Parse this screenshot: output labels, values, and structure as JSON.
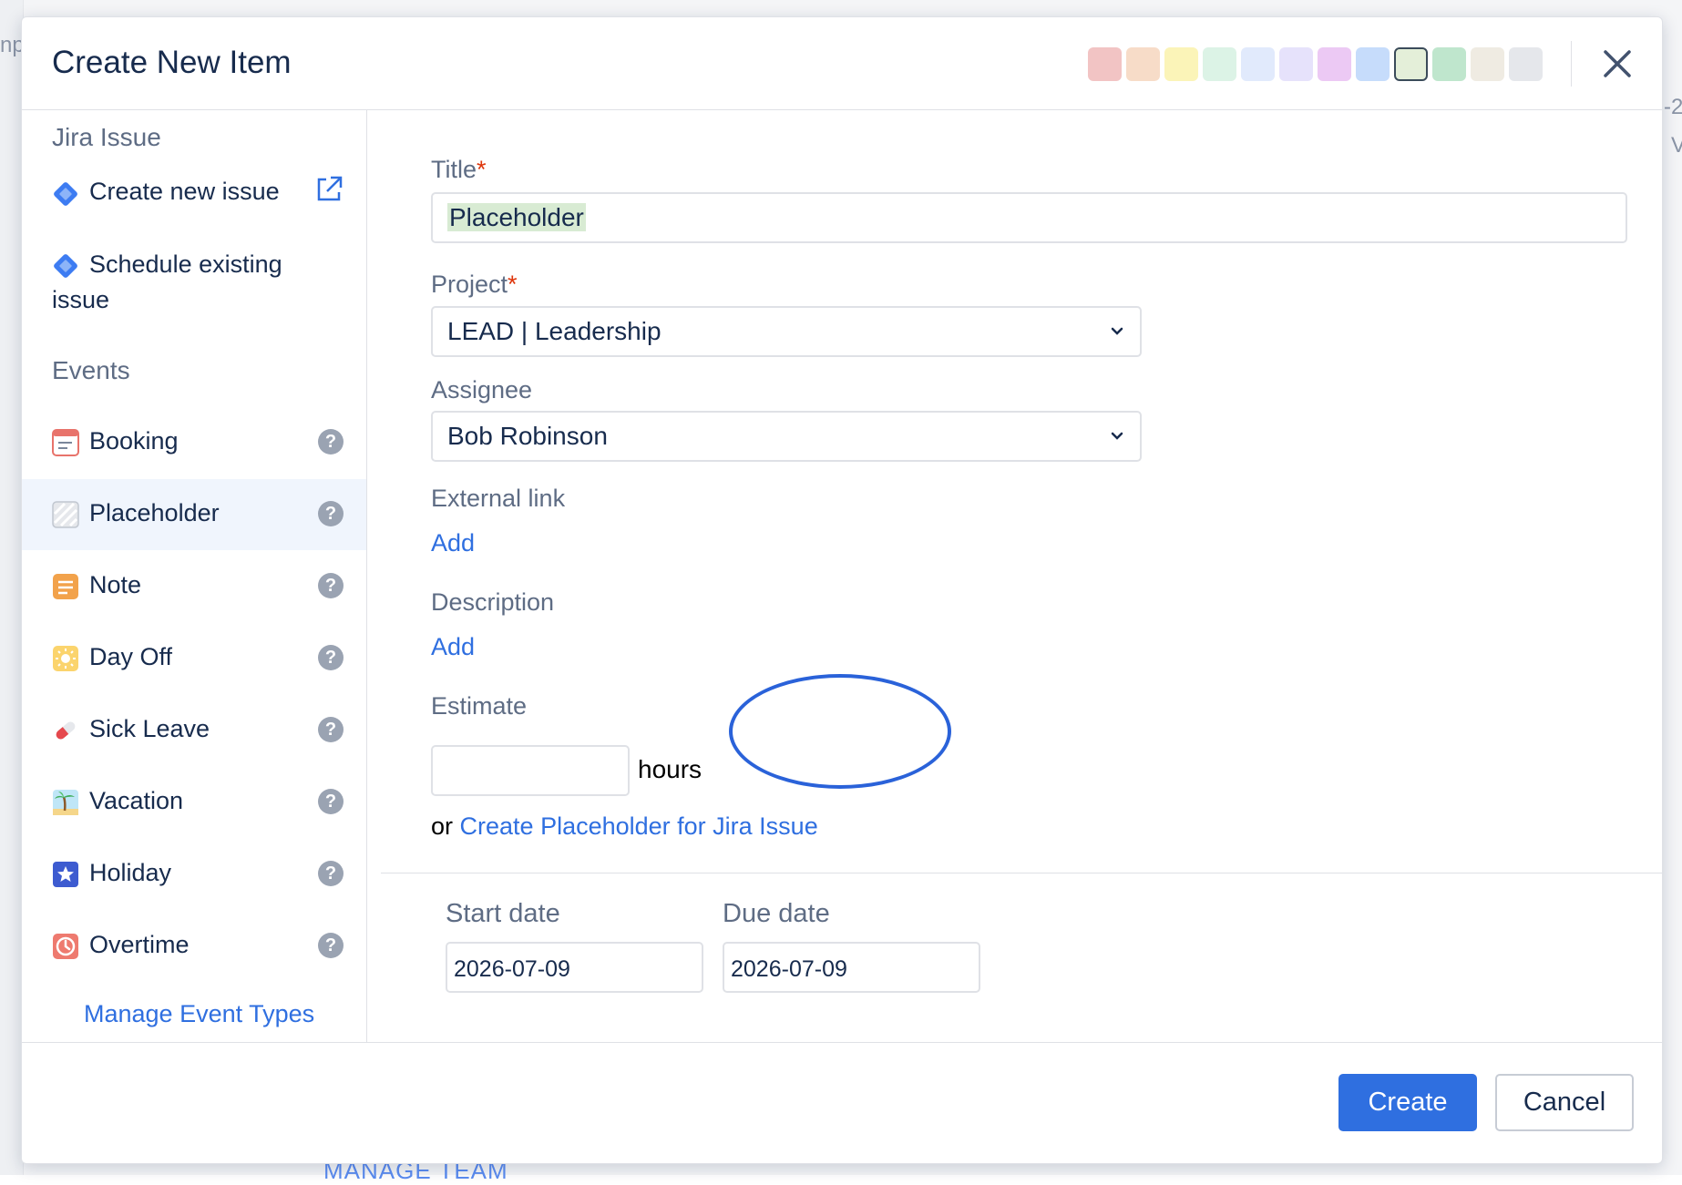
{
  "background": {
    "left_text": "np",
    "right_text_1": "-2",
    "right_text_2": "V",
    "bottom_text": "MANAGE TEAM"
  },
  "dialog": {
    "title": "Create New Item",
    "colors": [
      "#f2c4c4",
      "#f7dcc8",
      "#fbf4b8",
      "#dcf3e6",
      "#e1eafc",
      "#e6e2fb",
      "#ecc9f4",
      "#c6dcfb",
      "#e4efd9",
      "#bfe6cd",
      "#efebe2",
      "#e5e7eb"
    ],
    "selected_color_index": 8,
    "close_icon": "close-icon"
  },
  "sidebar": {
    "jira_heading": "Jira Issue",
    "jira_items": [
      {
        "label": "Create new issue",
        "icon": "jira-diamond-icon",
        "action_icon": "external-link-icon"
      },
      {
        "label": "Schedule existing",
        "label_line2": "issue",
        "icon": "jira-diamond-icon"
      }
    ],
    "events_heading": "Events",
    "events": [
      {
        "label": "Booking",
        "icon": "booking-icon"
      },
      {
        "label": "Placeholder",
        "icon": "placeholder-icon",
        "active": true
      },
      {
        "label": "Note",
        "icon": "note-icon"
      },
      {
        "label": "Day Off",
        "icon": "sun-icon"
      },
      {
        "label": "Sick Leave",
        "icon": "pill-icon"
      },
      {
        "label": "Vacation",
        "icon": "palm-tree-icon"
      },
      {
        "label": "Holiday",
        "icon": "star-icon"
      },
      {
        "label": "Overtime",
        "icon": "clock-icon"
      }
    ],
    "help_glyph": "?",
    "manage_link": "Manage Event Types"
  },
  "form": {
    "title_label": "Title",
    "required_mark": "*",
    "title_value": "Placeholder",
    "project_label": "Project",
    "project_value": "LEAD | Leadership",
    "assignee_label": "Assignee",
    "assignee_value": "Bob Robinson",
    "external_link_label": "External link",
    "external_link_add": "Add",
    "description_label": "Description",
    "description_add": "Add",
    "estimate_label": "Estimate",
    "estimate_value": "",
    "estimate_unit": "hours",
    "or_text": "or",
    "jira_placeholder_link": "Create Placeholder for Jira Issue",
    "start_date_label": "Start date",
    "start_date_value": "2026-07-09",
    "due_date_label": "Due date",
    "due_date_value": "2026-07-09"
  },
  "footer": {
    "create_label": "Create",
    "cancel_label": "Cancel"
  }
}
